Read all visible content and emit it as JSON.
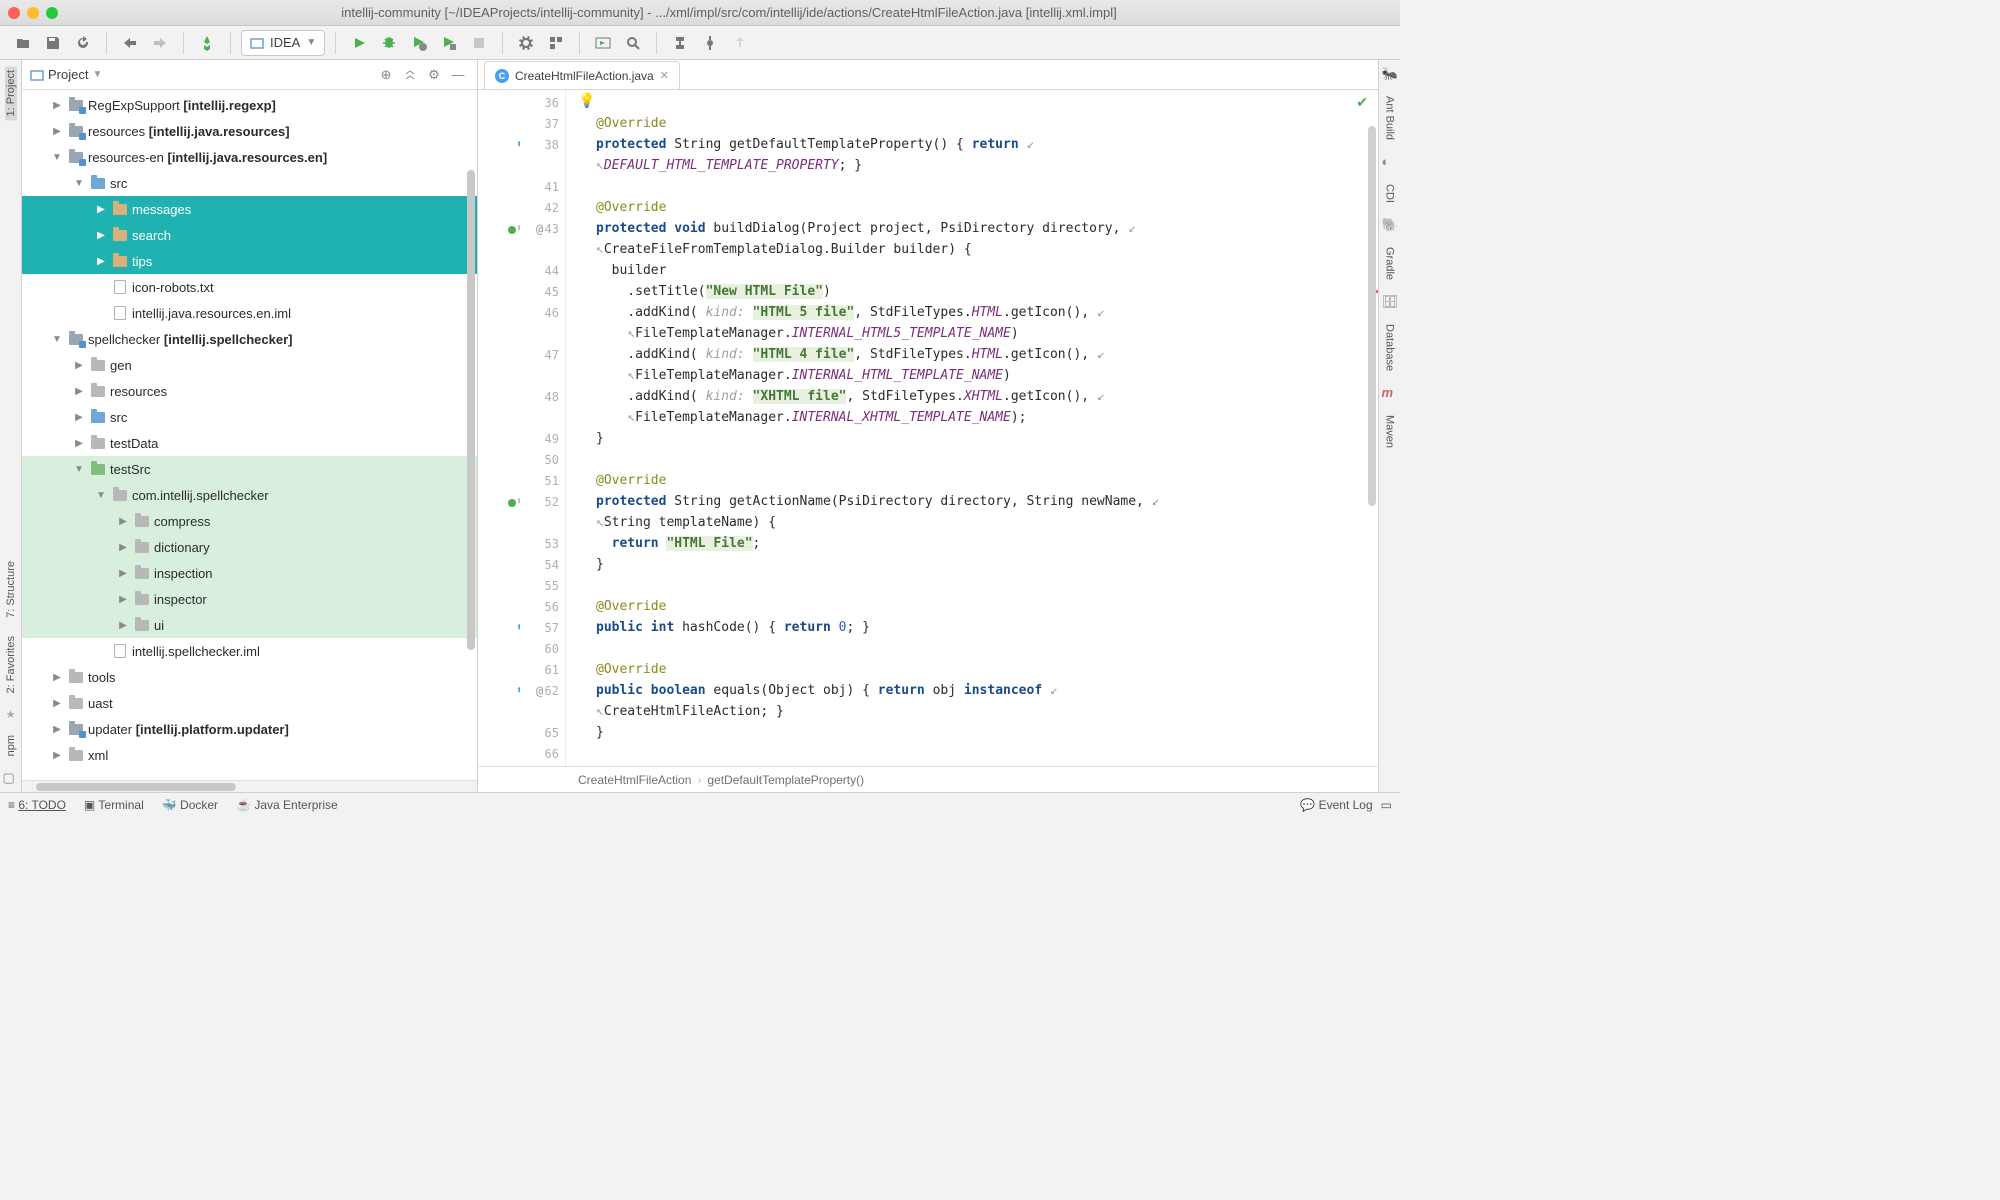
{
  "window": {
    "title": "intellij-community [~/IDEAProjects/intellij-community] - .../xml/impl/src/com/intellij/ide/actions/CreateHtmlFileAction.java [intellij.xml.impl]"
  },
  "toolbar": {
    "config_label": "IDEA"
  },
  "left_labels": [
    "1: Project",
    "7: Structure",
    "2: Favorites",
    "npm"
  ],
  "right_labels": [
    "Ant Build",
    "CDI",
    "Gradle",
    "Database",
    "Maven"
  ],
  "project": {
    "title": "Project",
    "items": [
      {
        "depth": 1,
        "arrow": "▶",
        "icon": "mod",
        "label": "RegExpSupport",
        "bold": "[intellij.regexp]",
        "sel": false
      },
      {
        "depth": 1,
        "arrow": "▶",
        "icon": "mod",
        "label": "resources",
        "bold": "[intellij.java.resources]",
        "sel": false
      },
      {
        "depth": 1,
        "arrow": "▼",
        "icon": "mod",
        "label": "resources-en",
        "bold": "[intellij.java.resources.en]",
        "sel": false
      },
      {
        "depth": 2,
        "arrow": "▼",
        "icon": "blue",
        "label": "src",
        "sel": false
      },
      {
        "depth": 3,
        "arrow": "▶",
        "icon": "fold",
        "label": "messages",
        "sel": true
      },
      {
        "depth": 3,
        "arrow": "▶",
        "icon": "fold",
        "label": "search",
        "sel": true
      },
      {
        "depth": 3,
        "arrow": "▶",
        "icon": "fold",
        "label": "tips",
        "sel": true
      },
      {
        "depth": 3,
        "arrow": "",
        "icon": "file",
        "label": "icon-robots.txt",
        "sel": false
      },
      {
        "depth": 3,
        "arrow": "",
        "icon": "file",
        "label": "intellij.java.resources.en.iml",
        "sel": false
      },
      {
        "depth": 1,
        "arrow": "▼",
        "icon": "mod",
        "label": "spellchecker",
        "bold": "[intellij.spellchecker]",
        "sel": false
      },
      {
        "depth": 2,
        "arrow": "▶",
        "icon": "grey",
        "label": "gen",
        "sel": false
      },
      {
        "depth": 2,
        "arrow": "▶",
        "icon": "grey",
        "label": "resources",
        "sel": false
      },
      {
        "depth": 2,
        "arrow": "▶",
        "icon": "blue",
        "label": "src",
        "sel": false
      },
      {
        "depth": 2,
        "arrow": "▶",
        "icon": "grey",
        "label": "testData",
        "sel": false
      },
      {
        "depth": 2,
        "arrow": "▼",
        "icon": "green",
        "label": "testSrc",
        "sel": false,
        "hl": true
      },
      {
        "depth": 3,
        "arrow": "▼",
        "icon": "grey",
        "label": "com.intellij.spellchecker",
        "sel": false,
        "hl": true
      },
      {
        "depth": 4,
        "arrow": "▶",
        "icon": "grey",
        "label": "compress",
        "sel": false,
        "hl": true
      },
      {
        "depth": 4,
        "arrow": "▶",
        "icon": "grey",
        "label": "dictionary",
        "sel": false,
        "hl": true
      },
      {
        "depth": 4,
        "arrow": "▶",
        "icon": "grey",
        "label": "inspection",
        "sel": false,
        "hl": true
      },
      {
        "depth": 4,
        "arrow": "▶",
        "icon": "grey",
        "label": "inspector",
        "sel": false,
        "hl": true
      },
      {
        "depth": 4,
        "arrow": "▶",
        "icon": "grey",
        "label": "ui",
        "sel": false,
        "hl": true
      },
      {
        "depth": 3,
        "arrow": "",
        "icon": "file",
        "label": "intellij.spellchecker.iml",
        "sel": false
      },
      {
        "depth": 1,
        "arrow": "▶",
        "icon": "grey",
        "label": "tools",
        "sel": false
      },
      {
        "depth": 1,
        "arrow": "▶",
        "icon": "grey",
        "label": "uast",
        "sel": false
      },
      {
        "depth": 1,
        "arrow": "▶",
        "icon": "mod",
        "label": "updater",
        "bold": "[intellij.platform.updater]",
        "sel": false
      },
      {
        "depth": 1,
        "arrow": "▶",
        "icon": "grey",
        "label": "xml",
        "sel": false
      }
    ]
  },
  "tab": {
    "label": "CreateHtmlFileAction.java"
  },
  "gutter_lines": [
    "36",
    "37",
    "38",
    "",
    "41",
    "42",
    "43",
    "",
    "44",
    "45",
    "46",
    "",
    "47",
    "",
    "48",
    "",
    "49",
    "50",
    "51",
    "52",
    "",
    "53",
    "54",
    "55",
    "56",
    "57",
    "60",
    "61",
    "62",
    "",
    "65",
    "66"
  ],
  "gutter_marks": {
    "2": "up",
    "6": "grn",
    "19": "grn",
    "25": "up",
    "28": "up"
  },
  "code_lines": [
    "",
    "<span class='ann'>@Override</span>",
    "<span class='kw'>protected</span> String getDefaultTemplateProperty() { <span class='kw'>return</span> <span class='wrap'>↙</span>",
    "<span class='wrap'>↖</span><span class='fld'>DEFAULT_HTML_TEMPLATE_PROPERTY</span>; }",
    "",
    "<span class='ann'>@Override</span>",
    "<span class='kw'>protected</span> <span class='kw'>void</span> buildDialog(Project project, PsiDirectory directory, <span class='wrap'>↙</span>",
    "<span class='wrap'>↖</span>CreateFileFromTemplateDialog.Builder builder) {",
    "  builder",
    "    .setTitle(<span class='str'>\"New HTML File\"</span>)",
    "    .addKind( <span class='cmt'>kind:</span> <span class='str'>\"HTML 5 file\"</span>, StdFileTypes.<span class='fld'>HTML</span>.getIcon(), <span class='wrap'>↙</span>",
    "    <span class='wrap'>↖</span>FileTemplateManager.<span class='fld'>INTERNAL_HTML5_TEMPLATE_NAME</span>)",
    "    .addKind( <span class='cmt'>kind:</span> <span class='str'>\"HTML 4 file\"</span>, StdFileTypes.<span class='fld'>HTML</span>.getIcon(), <span class='wrap'>↙</span>",
    "    <span class='wrap'>↖</span>FileTemplateManager.<span class='fld'>INTERNAL_HTML_TEMPLATE_NAME</span>)",
    "    .addKind( <span class='cmt'>kind:</span> <span class='str'>\"XHTML file\"</span>, StdFileTypes.<span class='fld'>XHTML</span>.getIcon(), <span class='wrap'>↙</span>",
    "    <span class='wrap'>↖</span>FileTemplateManager.<span class='fld'>INTERNAL_XHTML_TEMPLATE_NAME</span>);",
    "}",
    "",
    "<span class='ann'>@Override</span>",
    "<span class='kw'>protected</span> String getActionName(PsiDirectory directory, String newName, <span class='wrap'>↙</span>",
    "<span class='wrap'>↖</span>String templateName) {",
    "  <span class='kw'>return</span> <span class='str'>\"HTML File\"</span>;",
    "}",
    "",
    "<span class='ann'>@Override</span>",
    "<span class='kw'>public</span> <span class='kw'>int</span> hashCode() { <span class='kw'>return</span> <span class='num'>0</span>; }",
    "",
    "<span class='ann'>@Override</span>",
    "<span class='kw'>public</span> <span class='kw'>boolean</span> equals(Object obj) { <span class='kw'>return</span> obj <span class='kw'>instanceof</span> <span class='wrap'>↙</span>",
    "<span class='wrap'>↖</span>CreateHtmlFileAction; }",
    "}",
    ""
  ],
  "breadcrumbs": [
    "CreateHtmlFileAction",
    "getDefaultTemplateProperty()"
  ],
  "status": {
    "items": [
      "6: TODO",
      "Terminal",
      "Docker",
      "Java Enterprise"
    ],
    "right": "Event Log"
  }
}
